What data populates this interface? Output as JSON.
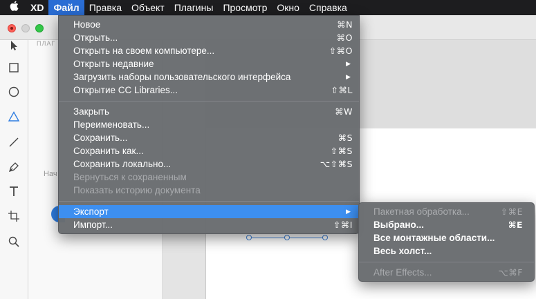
{
  "menubar": {
    "apple_icon": "apple-icon",
    "items": [
      "XD",
      "Файл",
      "Правка",
      "Объект",
      "Плагины",
      "Просмотр",
      "Окно",
      "Справка"
    ]
  },
  "layers_panel": {
    "label": "ПЛАГ",
    "home_label": "Нач"
  },
  "file_menu": {
    "group1": [
      {
        "label": "Новое",
        "shortcut": "⌘N"
      },
      {
        "label": "Открыть...",
        "shortcut": "⌘O"
      },
      {
        "label": "Открыть на своем компьютере...",
        "shortcut": "⇧⌘O"
      },
      {
        "label": "Открыть недавние",
        "submenu": "▶"
      },
      {
        "label": "Загрузить наборы пользовательского интерфейса",
        "submenu": "▶"
      },
      {
        "label": "Открытие CC Libraries...",
        "shortcut": "⇧⌘L"
      }
    ],
    "group2": [
      {
        "label": "Закрыть",
        "shortcut": "⌘W"
      },
      {
        "label": "Переименовать..."
      },
      {
        "label": "Сохранить...",
        "shortcut": "⌘S"
      },
      {
        "label": "Сохранить как...",
        "shortcut": "⇧⌘S"
      },
      {
        "label": "Сохранить локально...",
        "shortcut": "⌥⇧⌘S"
      },
      {
        "label": "Вернуться к сохраненным"
      },
      {
        "label": "Показать историю документа"
      }
    ],
    "group3": [
      {
        "label": "Экспорт",
        "submenu": "▶"
      },
      {
        "label": "Импорт...",
        "shortcut": "⇧⌘I"
      }
    ]
  },
  "export_menu": {
    "items": [
      {
        "label": "Пакетная обработка...",
        "shortcut": "⇧⌘E"
      },
      {
        "label": "Выбрано...",
        "shortcut": "⌘E"
      },
      {
        "label": "Все монтажные области..."
      },
      {
        "label": "Весь холст..."
      },
      {
        "label": "After Effects...",
        "shortcut": "⌥⌘F"
      }
    ]
  },
  "colors": {
    "menu_bg": "#696c70",
    "highlight": "#3d8ff0",
    "accent": "#2e7de1"
  }
}
